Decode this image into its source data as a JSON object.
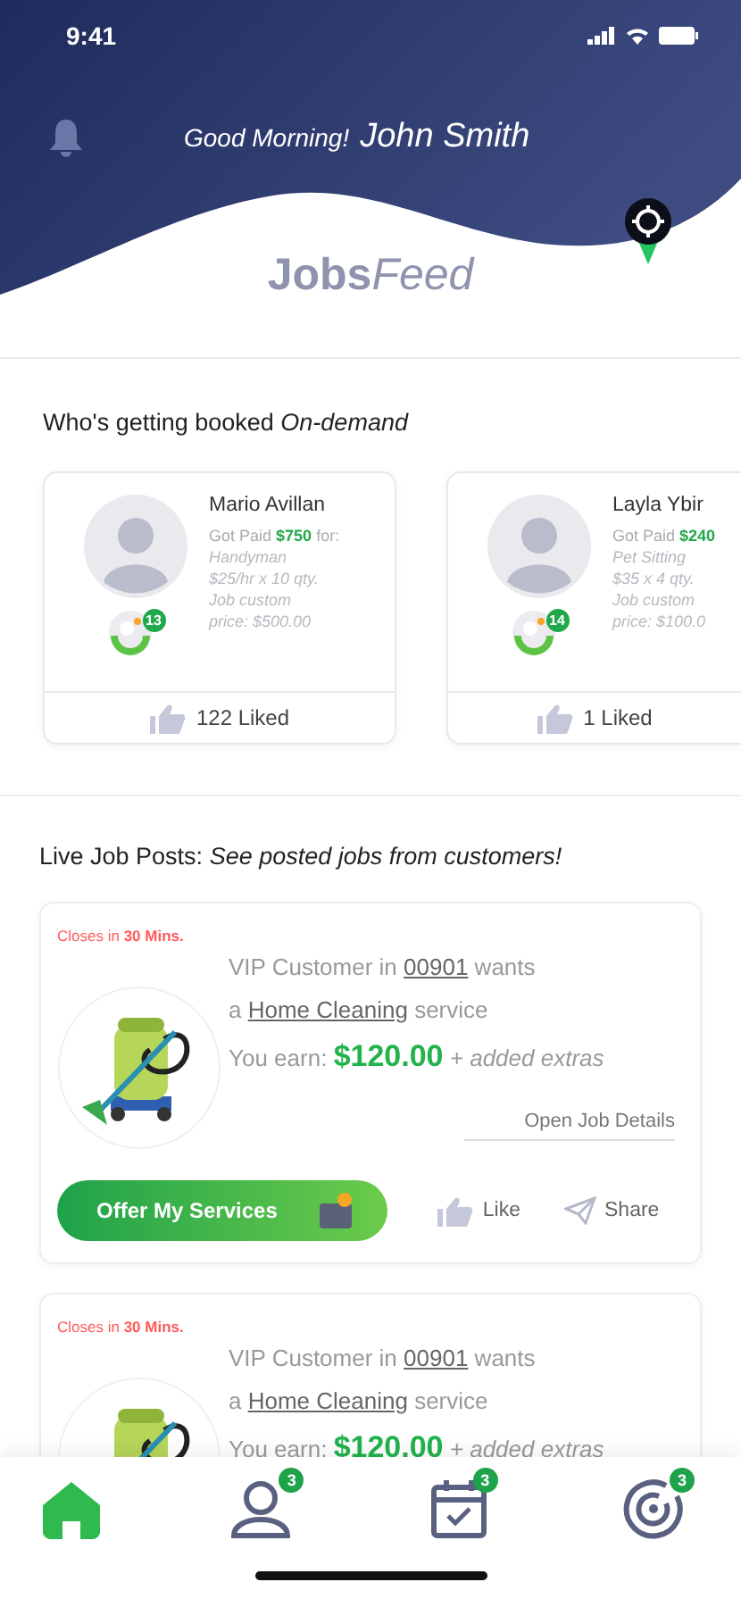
{
  "status_bar": {
    "time": "9:41"
  },
  "header": {
    "greeting": "Good Morning!",
    "user_name": "John Smith",
    "logo_bold": "Jobs",
    "logo_light": "Feed"
  },
  "booked_section": {
    "title": "Who's getting booked *On-demand*",
    "earners": [
      {
        "name": "Mario Avillan",
        "paid_label": "Got Paid",
        "amount": "$750",
        "paid_suffix": "for:",
        "service": "Handyman",
        "rate": "$25/hr x 10 qty.",
        "custom_label": "Job custom",
        "custom_price": "price: $500.00",
        "level_badge": "13",
        "likes": "122 Liked"
      },
      {
        "name": "Layla Ybir",
        "paid_label": "Got Paid",
        "amount": "$240",
        "service": "Pet Sitting",
        "rate": "$35 x 4 qty.",
        "custom_label": "Job custom",
        "custom_price": "price: $100.0",
        "level_badge": "14",
        "likes": "1 Liked"
      }
    ]
  },
  "jobs_section": {
    "title": "Live Job Posts: *See posted jobs from customers!*",
    "jobs": [
      {
        "closes": "Closes in **30 Mins.**",
        "line_1": {
          "before": "VIP Customer in",
          "link": "00901",
          "after": "wants"
        },
        "line_2": {
          "before": "a",
          "link": "Home Cleaning",
          "after": "service"
        },
        "earn_label": "You earn:",
        "earn_amount": "$120.00",
        "extras": "+ added extras",
        "details_link": "Open Job Details",
        "offer_button": "Offer My Services",
        "like": "Like",
        "share": "Share"
      },
      {
        "closes": "Closes in **30 Mins.**",
        "line_1": {
          "before": "VIP Customer in",
          "link": "00901",
          "after": "wants"
        },
        "line_2": {
          "before": "a",
          "link": "Home Cleaning",
          "after": "service"
        },
        "earn_label": "You earn:",
        "earn_amount": "$120.00",
        "extras": "+ added extras"
      }
    ]
  },
  "bottom_nav": [
    {
      "kind": "home",
      "selected": true
    },
    {
      "kind": "profile",
      "badge": "3",
      "selected": false
    },
    {
      "kind": "calendar",
      "badge": "3",
      "selected": false
    },
    {
      "kind": "target",
      "badge": "3",
      "selected": false
    }
  ]
}
